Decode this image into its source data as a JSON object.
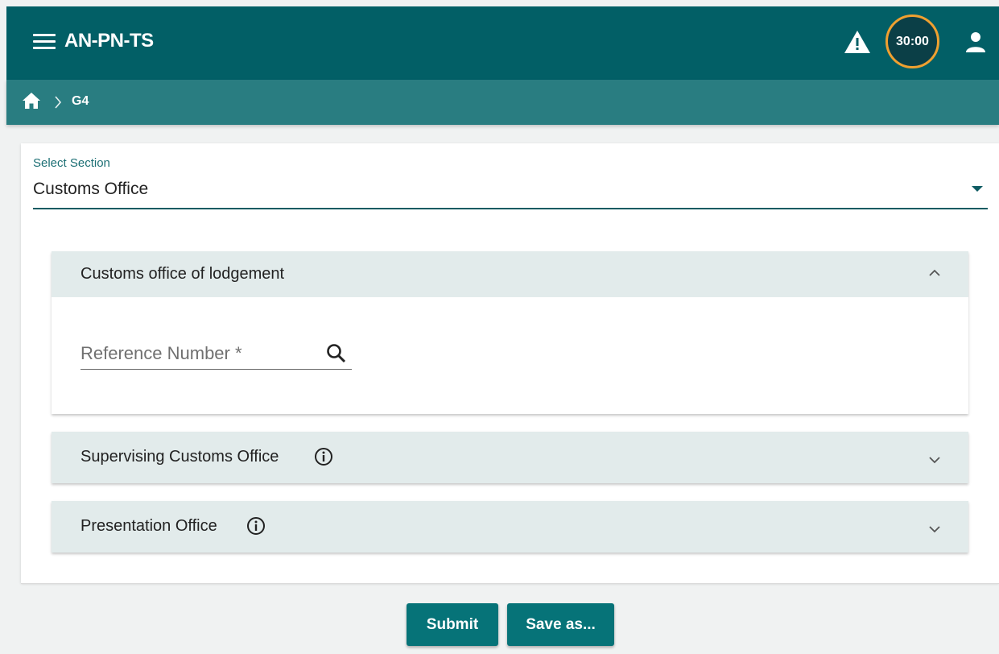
{
  "app": {
    "title": "AN-PN-TS",
    "timer": "30:00"
  },
  "breadcrumb": {
    "separator": ">",
    "current": "G4"
  },
  "section_select": {
    "label": "Select Section",
    "value": "Customs Office"
  },
  "panels": [
    {
      "title": "Customs office of lodgement",
      "expanded": true,
      "field": {
        "placeholder": "Reference Number *",
        "value": ""
      }
    },
    {
      "title": "Supervising Customs Office",
      "expanded": false
    },
    {
      "title": "Presentation Office",
      "expanded": false
    }
  ],
  "buttons": {
    "submit": "Submit",
    "save_as": "Save as..."
  },
  "colors": {
    "topbar": "#025f66",
    "breadcrumb": "#297d81",
    "accent": "#067378",
    "timer_ring": "#f0a030"
  }
}
